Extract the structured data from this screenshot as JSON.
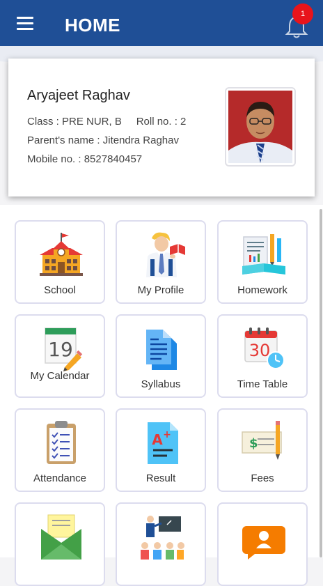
{
  "appbar": {
    "title": "HOME",
    "notification_count": "1",
    "colors": {
      "primary": "#1f4f96",
      "badge": "#e8141b"
    }
  },
  "student": {
    "name": "Aryajeet Raghav",
    "class_roll": "Class : PRE NUR, B     Roll no. : 2",
    "parent": "Parent's name : Jitendra Raghav",
    "mobile": "Mobile no. : 8527840457"
  },
  "menu": [
    {
      "label": "School",
      "icon": "school-building-icon"
    },
    {
      "label": "My Profile",
      "icon": "teacher-profile-icon"
    },
    {
      "label": "Homework",
      "icon": "homework-book-icon"
    },
    {
      "label": "My Calendar",
      "icon": "calendar-19-icon"
    },
    {
      "label": "Syllabus",
      "icon": "documents-icon"
    },
    {
      "label": "Time Table",
      "icon": "calendar-clock-icon"
    },
    {
      "label": "Attendance",
      "icon": "clipboard-checklist-icon"
    },
    {
      "label": "Result",
      "icon": "grade-report-icon"
    },
    {
      "label": "Fees",
      "icon": "cheque-pencil-icon"
    },
    {
      "label": "",
      "icon": "envelope-letter-icon"
    },
    {
      "label": "",
      "icon": "classroom-teacher-icon"
    },
    {
      "label": "",
      "icon": "chat-person-icon"
    }
  ]
}
